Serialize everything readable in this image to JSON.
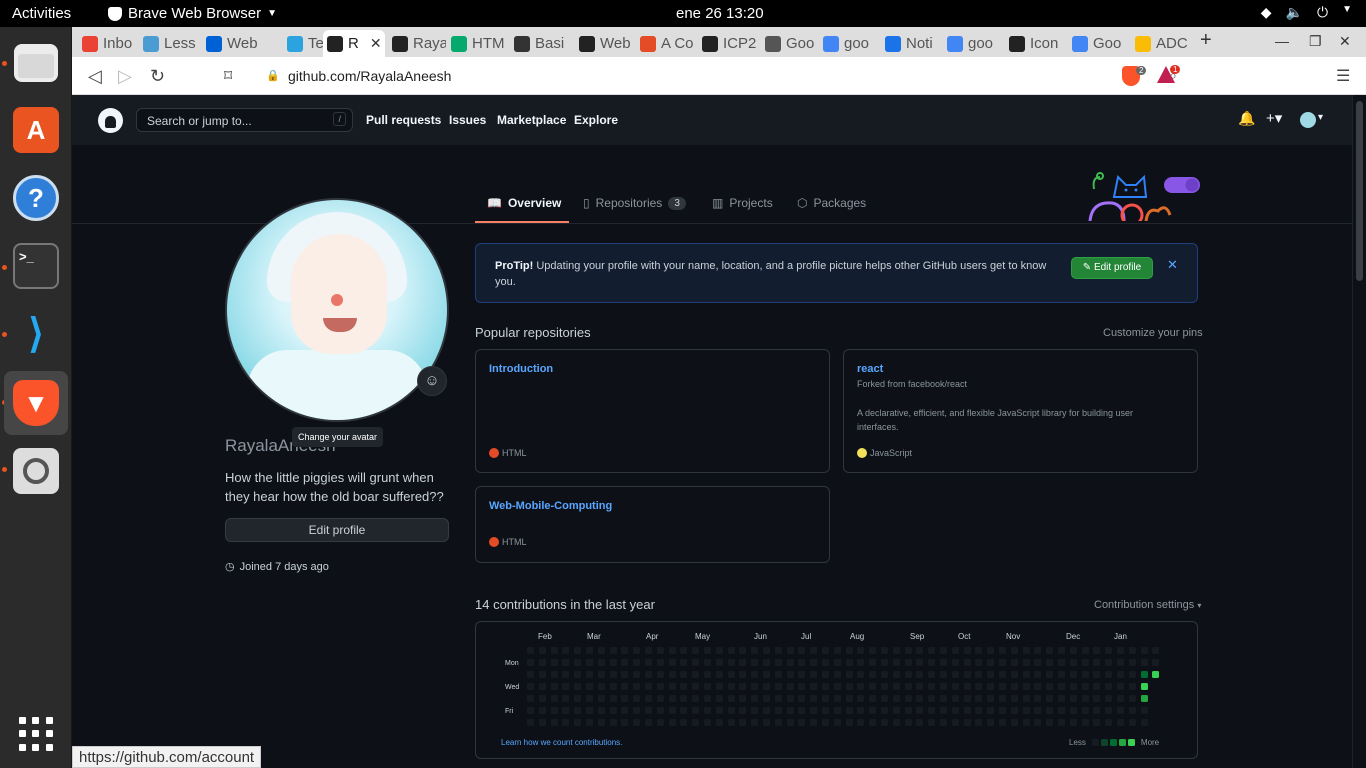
{
  "system": {
    "activities": "Activities",
    "app_name": "Brave Web Browser",
    "clock": "ene 26  13:20"
  },
  "dock": {
    "apps": [
      "Files",
      "Ubuntu Software",
      "Help",
      "Terminal",
      "Visual Studio Code",
      "Brave Browser",
      "Image Viewer"
    ],
    "show_apps": "Show Applications"
  },
  "browser": {
    "tabs": [
      {
        "label": "Inbo",
        "icon": "gmail-icon",
        "color": "#ea4335"
      },
      {
        "label": "Less",
        "icon": "unc-icon",
        "color": "#4b9cd3"
      },
      {
        "label": "Web",
        "icon": "box-icon",
        "color": "#0061d5"
      },
      {
        "label": "Tele",
        "icon": "telegram-icon",
        "color": "#2aa3df"
      },
      {
        "label": "R",
        "icon": "github-icon",
        "color": "#222222",
        "active": true
      },
      {
        "label": "Raya",
        "icon": "github-icon",
        "color": "#222222"
      },
      {
        "label": "HTM",
        "icon": "w3schools-icon",
        "color": "#04aa6d"
      },
      {
        "label": "Basi",
        "icon": "markdown-icon",
        "color": "#333333"
      },
      {
        "label": "Web",
        "icon": "github-icon",
        "color": "#222222"
      },
      {
        "label": "A Co",
        "icon": "asterisk-icon",
        "color": "#e34c26"
      },
      {
        "label": "ICP2",
        "icon": "github-icon",
        "color": "#222222"
      },
      {
        "label": "Goo",
        "icon": "globe-icon",
        "color": "#555555"
      },
      {
        "label": "goo",
        "icon": "google-icon",
        "color": "#4285f4"
      },
      {
        "label": "Noti",
        "icon": "flag-icon",
        "color": "#1a73e8"
      },
      {
        "label": "goo",
        "icon": "google-icon",
        "color": "#4285f4"
      },
      {
        "label": "Icon",
        "icon": "github-icon",
        "color": "#222222"
      },
      {
        "label": "Goo",
        "icon": "google-icon",
        "color": "#4285f4"
      },
      {
        "label": "ADC",
        "icon": "pinwheel-icon",
        "color": "#fbbc05"
      }
    ],
    "url": "github.com/RayalaAneesh",
    "shield_count": "2",
    "rewards_count": "1",
    "status_url": "https://github.com/account"
  },
  "github": {
    "search_placeholder": "Search or jump to...",
    "search_key": "/",
    "nav": [
      "Pull requests",
      "Issues",
      "Marketplace",
      "Explore"
    ],
    "profile_tabs": [
      {
        "label": "Overview",
        "count": null
      },
      {
        "label": "Repositories",
        "count": "3"
      },
      {
        "label": "Projects",
        "count": null
      },
      {
        "label": "Packages",
        "count": null
      }
    ],
    "tooltip": "Change your avatar",
    "username": "RayalaAneesh",
    "bio": "How the little piggies will grunt when they hear how the old boar suffered??",
    "edit_profile": "Edit profile",
    "joined": "Joined 7 days ago",
    "protip": {
      "title": "ProTip!",
      "text": " Updating your profile with your name, location, and a profile picture helps other GitHub users get to know you.",
      "button": "Edit profile"
    },
    "popular_title": "Popular repositories",
    "customize_pins": "Customize your pins",
    "repos": [
      {
        "name": "Introduction",
        "forked": "",
        "description": "",
        "language": "HTML",
        "lang_color": "#e34c26"
      },
      {
        "name": "react",
        "forked": "Forked from facebook/react",
        "description": "A declarative, efficient, and flexible JavaScript library for building user interfaces.",
        "language": "JavaScript",
        "lang_color": "#f1e05a"
      },
      {
        "name": "Web-Mobile-Computing",
        "forked": "",
        "description": "",
        "language": "HTML",
        "lang_color": "#e34c26"
      }
    ],
    "contrib_title": "14 contributions in the last year",
    "contrib_settings": "Contribution settings",
    "months": [
      "Feb",
      "Mar",
      "Apr",
      "May",
      "Jun",
      "Jul",
      "Aug",
      "Sep",
      "Oct",
      "Nov",
      "Dec",
      "Jan"
    ],
    "day_labels": [
      "Mon",
      "Wed",
      "Fri"
    ],
    "learn_link": "Learn how we count contributions.",
    "legend_less": "Less",
    "legend_more": "More",
    "active_days": [
      {
        "week": 52,
        "day": 2,
        "level": 2
      },
      {
        "week": 53,
        "day": 2,
        "level": 4
      },
      {
        "week": 52,
        "day": 3,
        "level": 4
      },
      {
        "week": 52,
        "day": 4,
        "level": 3
      }
    ]
  }
}
